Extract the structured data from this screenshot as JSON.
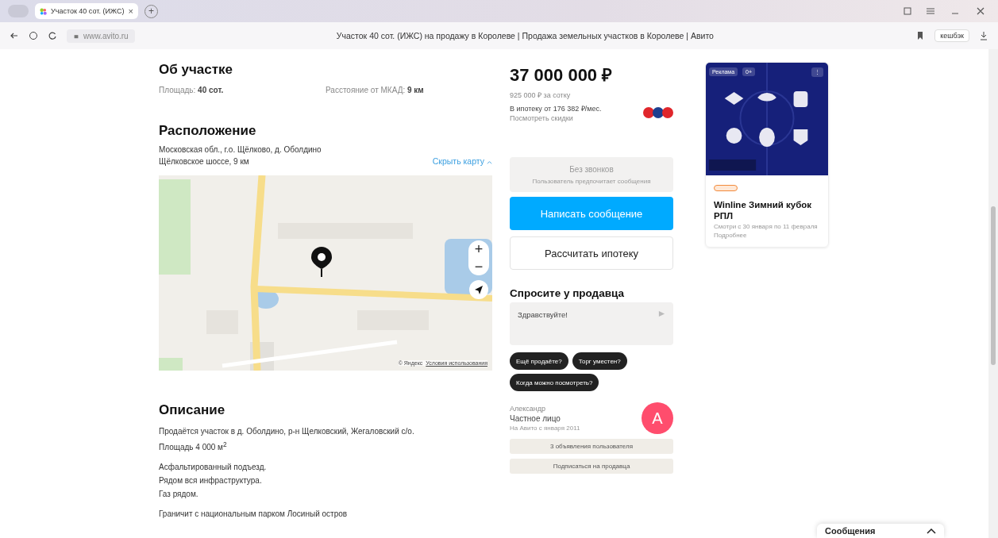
{
  "browser": {
    "tab": {
      "title": "Участок 40 сот. (ИЖС)",
      "close": "×"
    },
    "new_tab": "+",
    "address": "www.avito.ru",
    "page_title": "Участок 40 сот. (ИЖС) на продажу в Королеве | Продажа земельных участков в Королеве | Авито",
    "cashback": "кешбэк"
  },
  "about": {
    "title": "Об участке",
    "params": [
      {
        "label": "Площадь:",
        "value": "40 сот."
      },
      {
        "label": "Расстояние от МКАД:",
        "value": "9 км"
      }
    ]
  },
  "location": {
    "title": "Расположение",
    "address": "Московская обл., г.о. Щёлково, д. Оболдино",
    "highway": "Щёлковское шоссе, 9 км",
    "hide_map": "Скрыть карту",
    "map": {
      "zoom_in": "+",
      "zoom_out": "−",
      "copyright": "© Яндекс",
      "terms": "Условия использования"
    }
  },
  "description": {
    "title": "Описание",
    "paragraphs": [
      "Продаётся участок в д. Оболдино, р-н Щелковский, Жегаловский с/о.\nПлощадь 4 000 м$^{2}$",
      "Асфальтированный подъезд.\nРядом вся инфраструктура.\nГаз рядом.",
      "Граничит с национальным парком Лосиный остров"
    ]
  },
  "price": {
    "amount": "37 000 000 ₽",
    "per_unit": "925 000 ₽ за сотку",
    "mortgage": "В ипотеку от 176 382 ₽/мес.",
    "discounts": "Посмотреть скидки"
  },
  "no_calls": {
    "title": "Без звонков",
    "subtitle": "Пользователь предпочитает сообщения"
  },
  "buttons": [
    {
      "label": "Написать сообщение",
      "kind": "primary"
    },
    {
      "label": "Рассчитать ипотеку",
      "kind": "secondary"
    }
  ],
  "ask": {
    "title": "Спросите у продавца",
    "message": "Здравствуйте!",
    "chips": [
      "Ещё продаёте?",
      "Торг уместен?",
      "Когда можно посмотреть?"
    ]
  },
  "seller": {
    "name": "Александр",
    "type": "Частное лицо",
    "since": "На Авито с января 2011",
    "avatar": "А",
    "color": "#ff4d6d",
    "links": [
      "3 объявления пользователя",
      "Подписаться на продавца"
    ]
  },
  "ad": {
    "badge": "Реклама",
    "age": "0+",
    "more": "⋮",
    "title": "Winline Зимний кубок РПЛ",
    "text": "Смотри с 30 января по 11 февраля",
    "link": "Подробнее"
  },
  "messages": {
    "label": "Сообщения",
    "expanded": false
  }
}
